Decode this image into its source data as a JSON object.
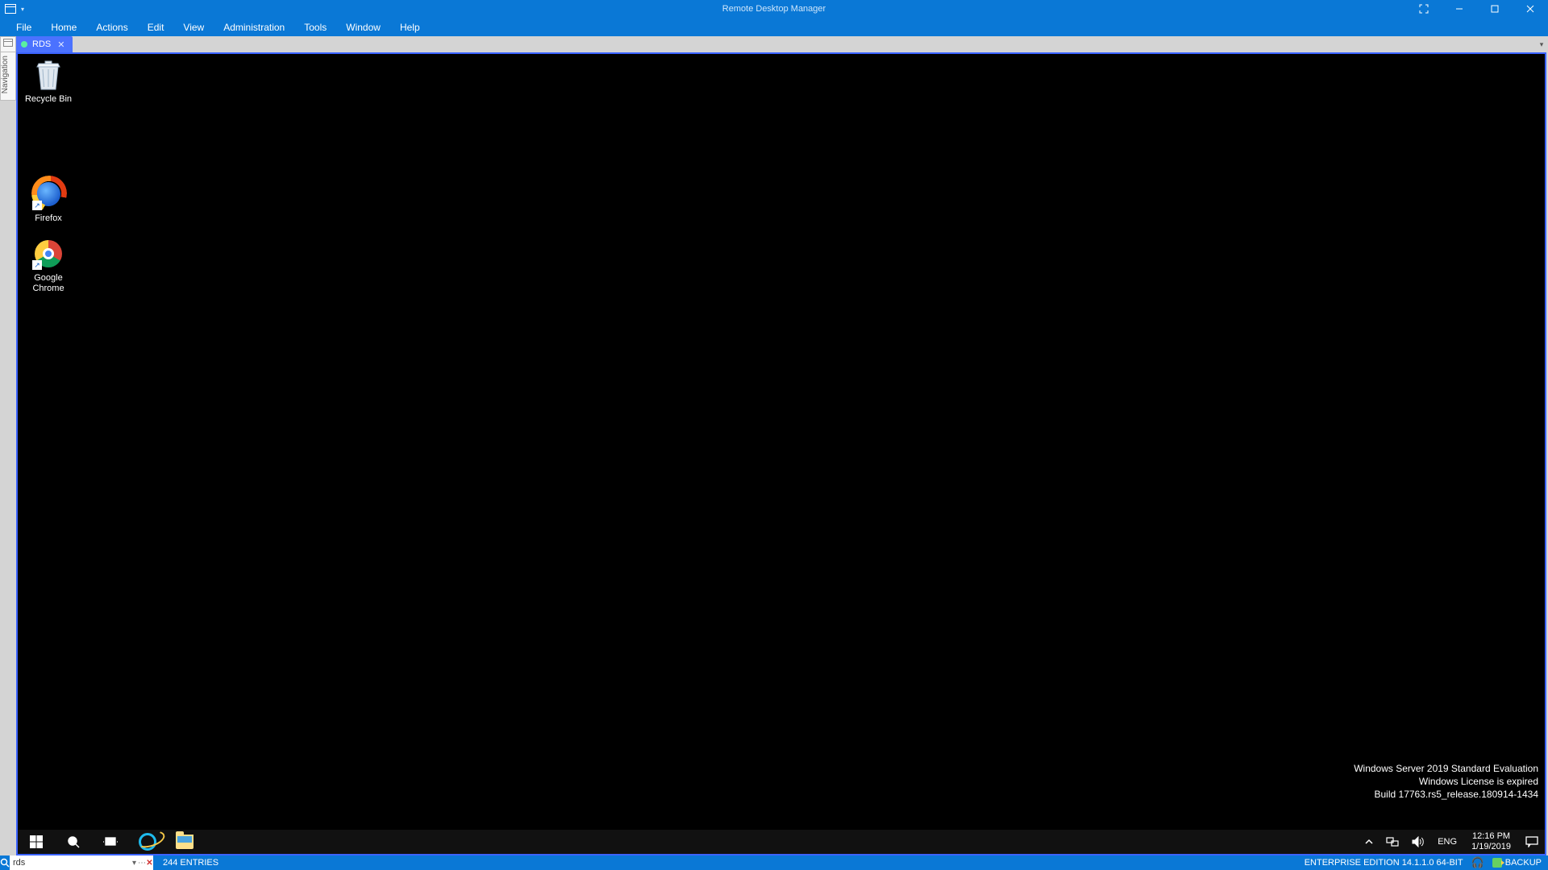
{
  "titlebar": {
    "title": "Remote Desktop Manager"
  },
  "menu": {
    "items": [
      "File",
      "Home",
      "Actions",
      "Edit",
      "View",
      "Administration",
      "Tools",
      "Window",
      "Help"
    ]
  },
  "navigation": {
    "label": "Navigation"
  },
  "tab": {
    "label": "RDS"
  },
  "desktop": {
    "icons": {
      "recycle": "Recycle Bin",
      "firefox": "Firefox",
      "chrome": "Google Chrome"
    },
    "watermark": {
      "line1": "Windows Server 2019 Standard Evaluation",
      "line2": "Windows License is expired",
      "line3": "Build 17763.rs5_release.180914-1434"
    }
  },
  "remote_taskbar": {
    "lang": "ENG",
    "time": "12:16 PM",
    "date": "1/19/2019"
  },
  "statusbar": {
    "search_value": "rds",
    "entries": "244 ENTRIES",
    "edition": "ENTERPRISE EDITION 14.1.1.0 64-BIT",
    "backup": "BACKUP"
  }
}
